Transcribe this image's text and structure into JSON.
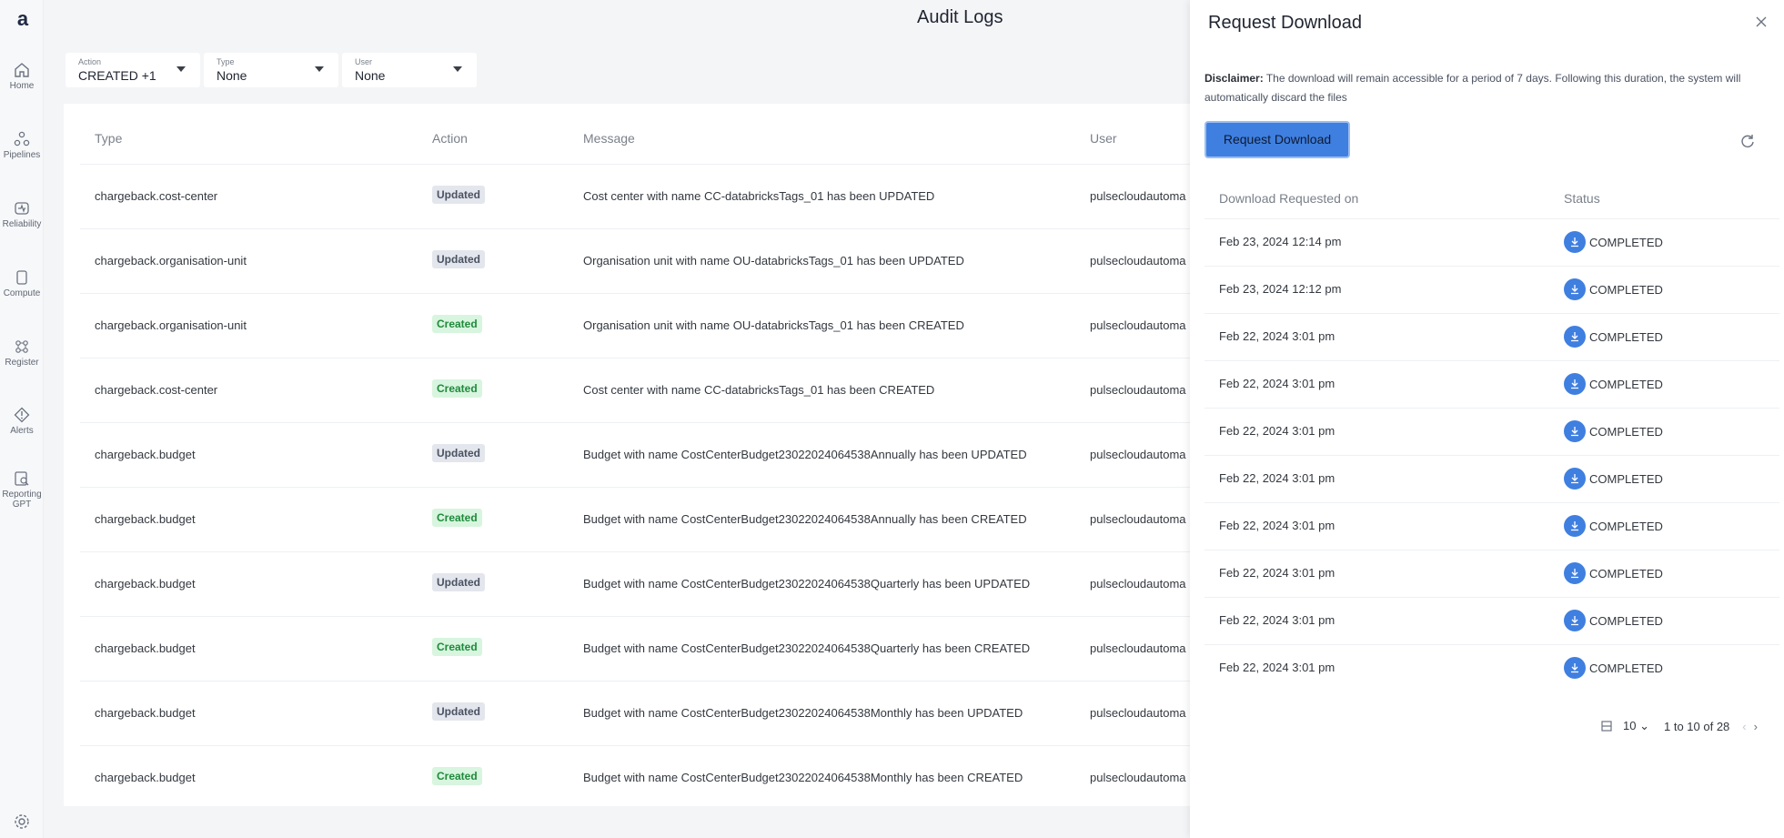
{
  "app": {
    "logo_letter": "a"
  },
  "sidebar": {
    "items": [
      {
        "label": "Home",
        "icon": "home-icon"
      },
      {
        "label": "Pipelines",
        "icon": "pipelines-icon"
      },
      {
        "label": "Reliability",
        "icon": "reliability-icon"
      },
      {
        "label": "Compute",
        "icon": "compute-icon"
      },
      {
        "label": "Register",
        "icon": "register-icon"
      },
      {
        "label": "Alerts",
        "icon": "alerts-icon"
      },
      {
        "label": "Reporting GPT",
        "icon": "reporting-icon"
      }
    ],
    "settings_icon": "gear-icon"
  },
  "page": {
    "title": "Audit Logs"
  },
  "filters": [
    {
      "label": "Action",
      "value": "CREATED +1"
    },
    {
      "label": "Type",
      "value": "None"
    },
    {
      "label": "User",
      "value": "None"
    }
  ],
  "table": {
    "columns": [
      "Type",
      "Action",
      "Message",
      "User"
    ],
    "rows": [
      {
        "type": "chargeback.cost-center",
        "action": "Updated",
        "message": "Cost center with name CC-databricksTags_01 has been UPDATED",
        "user": "pulsecloudautoma"
      },
      {
        "type": "chargeback.organisation-unit",
        "action": "Updated",
        "message": "Organisation unit with name OU-databricksTags_01 has been UPDATED",
        "user": "pulsecloudautoma"
      },
      {
        "type": "chargeback.organisation-unit",
        "action": "Created",
        "message": "Organisation unit with name OU-databricksTags_01 has been CREATED",
        "user": "pulsecloudautoma"
      },
      {
        "type": "chargeback.cost-center",
        "action": "Created",
        "message": "Cost center with name CC-databricksTags_01 has been CREATED",
        "user": "pulsecloudautoma"
      },
      {
        "type": "chargeback.budget",
        "action": "Updated",
        "message": "Budget with name CostCenterBudget23022024064538Annually has been UPDATED",
        "user": "pulsecloudautoma"
      },
      {
        "type": "chargeback.budget",
        "action": "Created",
        "message": "Budget with name CostCenterBudget23022024064538Annually has been CREATED",
        "user": "pulsecloudautoma"
      },
      {
        "type": "chargeback.budget",
        "action": "Updated",
        "message": "Budget with name CostCenterBudget23022024064538Quarterly has been UPDATED",
        "user": "pulsecloudautoma"
      },
      {
        "type": "chargeback.budget",
        "action": "Created",
        "message": "Budget with name CostCenterBudget23022024064538Quarterly has been CREATED",
        "user": "pulsecloudautoma"
      },
      {
        "type": "chargeback.budget",
        "action": "Updated",
        "message": "Budget with name CostCenterBudget23022024064538Monthly has been UPDATED",
        "user": "pulsecloudautoma"
      },
      {
        "type": "chargeback.budget",
        "action": "Created",
        "message": "Budget with name CostCenterBudget23022024064538Monthly has been CREATED",
        "user": "pulsecloudautoma"
      }
    ]
  },
  "drawer": {
    "title": "Request Download",
    "disclaimer_label": "Disclaimer:",
    "disclaimer_text": " The download will remain accessible for a period of 7 days. Following this duration, the system will automatically discard the files",
    "request_button": "Request Download",
    "columns": [
      "Download Requested on",
      "Status"
    ],
    "downloads": [
      {
        "requested_on": "Feb 23, 2024 12:14 pm",
        "status": "COMPLETED"
      },
      {
        "requested_on": "Feb 23, 2024 12:12 pm",
        "status": "COMPLETED"
      },
      {
        "requested_on": "Feb 22, 2024 3:01 pm",
        "status": "COMPLETED"
      },
      {
        "requested_on": "Feb 22, 2024 3:01 pm",
        "status": "COMPLETED"
      },
      {
        "requested_on": "Feb 22, 2024 3:01 pm",
        "status": "COMPLETED"
      },
      {
        "requested_on": "Feb 22, 2024 3:01 pm",
        "status": "COMPLETED"
      },
      {
        "requested_on": "Feb 22, 2024 3:01 pm",
        "status": "COMPLETED"
      },
      {
        "requested_on": "Feb 22, 2024 3:01 pm",
        "status": "COMPLETED"
      },
      {
        "requested_on": "Feb 22, 2024 3:01 pm",
        "status": "COMPLETED"
      },
      {
        "requested_on": "Feb 22, 2024 3:01 pm",
        "status": "COMPLETED"
      }
    ],
    "pagination": {
      "page_size": "10",
      "range_text": "1 to 10 of 28"
    }
  },
  "colors": {
    "accent": "#3f7fe0",
    "created_badge_bg": "#d8f5df",
    "updated_badge_bg": "#e3e6ec"
  }
}
